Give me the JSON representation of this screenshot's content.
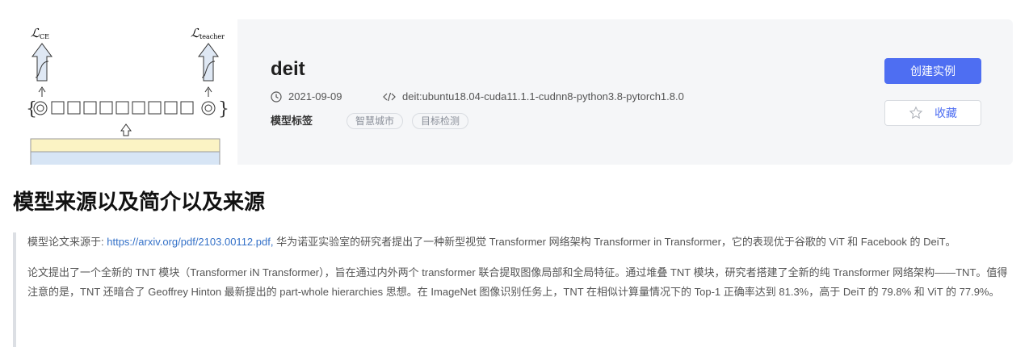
{
  "model": {
    "name": "deit",
    "date": "2021-09-09",
    "image": "deit:ubuntu18.04-cuda11.1.1-cudnn8-python3.8-pytorch1.8.0",
    "tags_label": "模型标签",
    "tags": [
      "智慧城市",
      "目标检测"
    ]
  },
  "thumbnail": {
    "loss_ce": "ℒ",
    "loss_ce_sub": "CE",
    "loss_teacher": "ℒ",
    "loss_teacher_sub": "teacher"
  },
  "actions": {
    "create_label": "创建实例",
    "favorite_label": "收藏"
  },
  "section": {
    "title": "模型来源以及简介以及来源",
    "para1_prefix": "模型论文来源于: ",
    "para1_link": "https://arxiv.org/pdf/2103.00112.pdf,",
    "para1_text": " 华为诺亚实验室的研究者提出了一种新型视觉 Transformer 网络架构 Transformer in Transformer，它的表现优于谷歌的 ViT 和 Facebook 的 DeiT。",
    "para2": "论文提出了一个全新的 TNT 模块（Transformer iN Transformer），旨在通过内外两个 transformer 联合提取图像局部和全局特征。通过堆叠 TNT 模块，研究者搭建了全新的纯 Transformer 网络架构——TNT。值得注意的是，TNT 还暗合了 Geoffrey Hinton 最新提出的 part-whole hierarchies 思想。在 ImageNet 图像识别任务上，TNT 在相似计算量情况下的 Top-1 正确率达到 81.3%，高于 DeiT 的 79.8% 和 ViT 的 77.9%。"
  },
  "colors": {
    "primary": "#4e6ef2",
    "link": "#3471c8",
    "card_bg": "#f5f6f8"
  },
  "icons": [
    "clock-icon",
    "code-icon",
    "star-icon"
  ]
}
